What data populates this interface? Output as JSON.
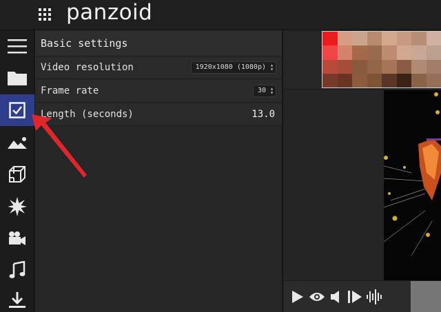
{
  "app": {
    "logo": "panzoid"
  },
  "sidebar": {
    "items": [
      {
        "name": "menu",
        "icon": "hamburger-menu-icon"
      },
      {
        "name": "files",
        "icon": "folder-icon"
      },
      {
        "name": "basic-settings",
        "icon": "checkbox-icon",
        "active": true
      },
      {
        "name": "backgrounds",
        "icon": "landscape-image-icon"
      },
      {
        "name": "3d-objects",
        "icon": "cube-icon"
      },
      {
        "name": "effects",
        "icon": "starburst-icon"
      },
      {
        "name": "camera",
        "icon": "video-camera-icon"
      },
      {
        "name": "audio",
        "icon": "music-note-icon"
      },
      {
        "name": "render",
        "icon": "download-icon"
      }
    ]
  },
  "panel": {
    "title": "Basic settings",
    "rows": {
      "resolution": {
        "label": "Video resolution",
        "value": "1920x1080 (1080p)"
      },
      "framerate": {
        "label": "Frame rate",
        "value": "30"
      },
      "length": {
        "label": "Length (seconds)",
        "value": "13.0"
      }
    }
  },
  "colors": {
    "active_sidebar": "#2f3e8c",
    "annotation_arrow": "#e0262b"
  },
  "controls": {
    "icons": [
      "play-icon",
      "eye-icon",
      "volume-icon",
      "step-forward-icon",
      "waveform-icon"
    ]
  }
}
